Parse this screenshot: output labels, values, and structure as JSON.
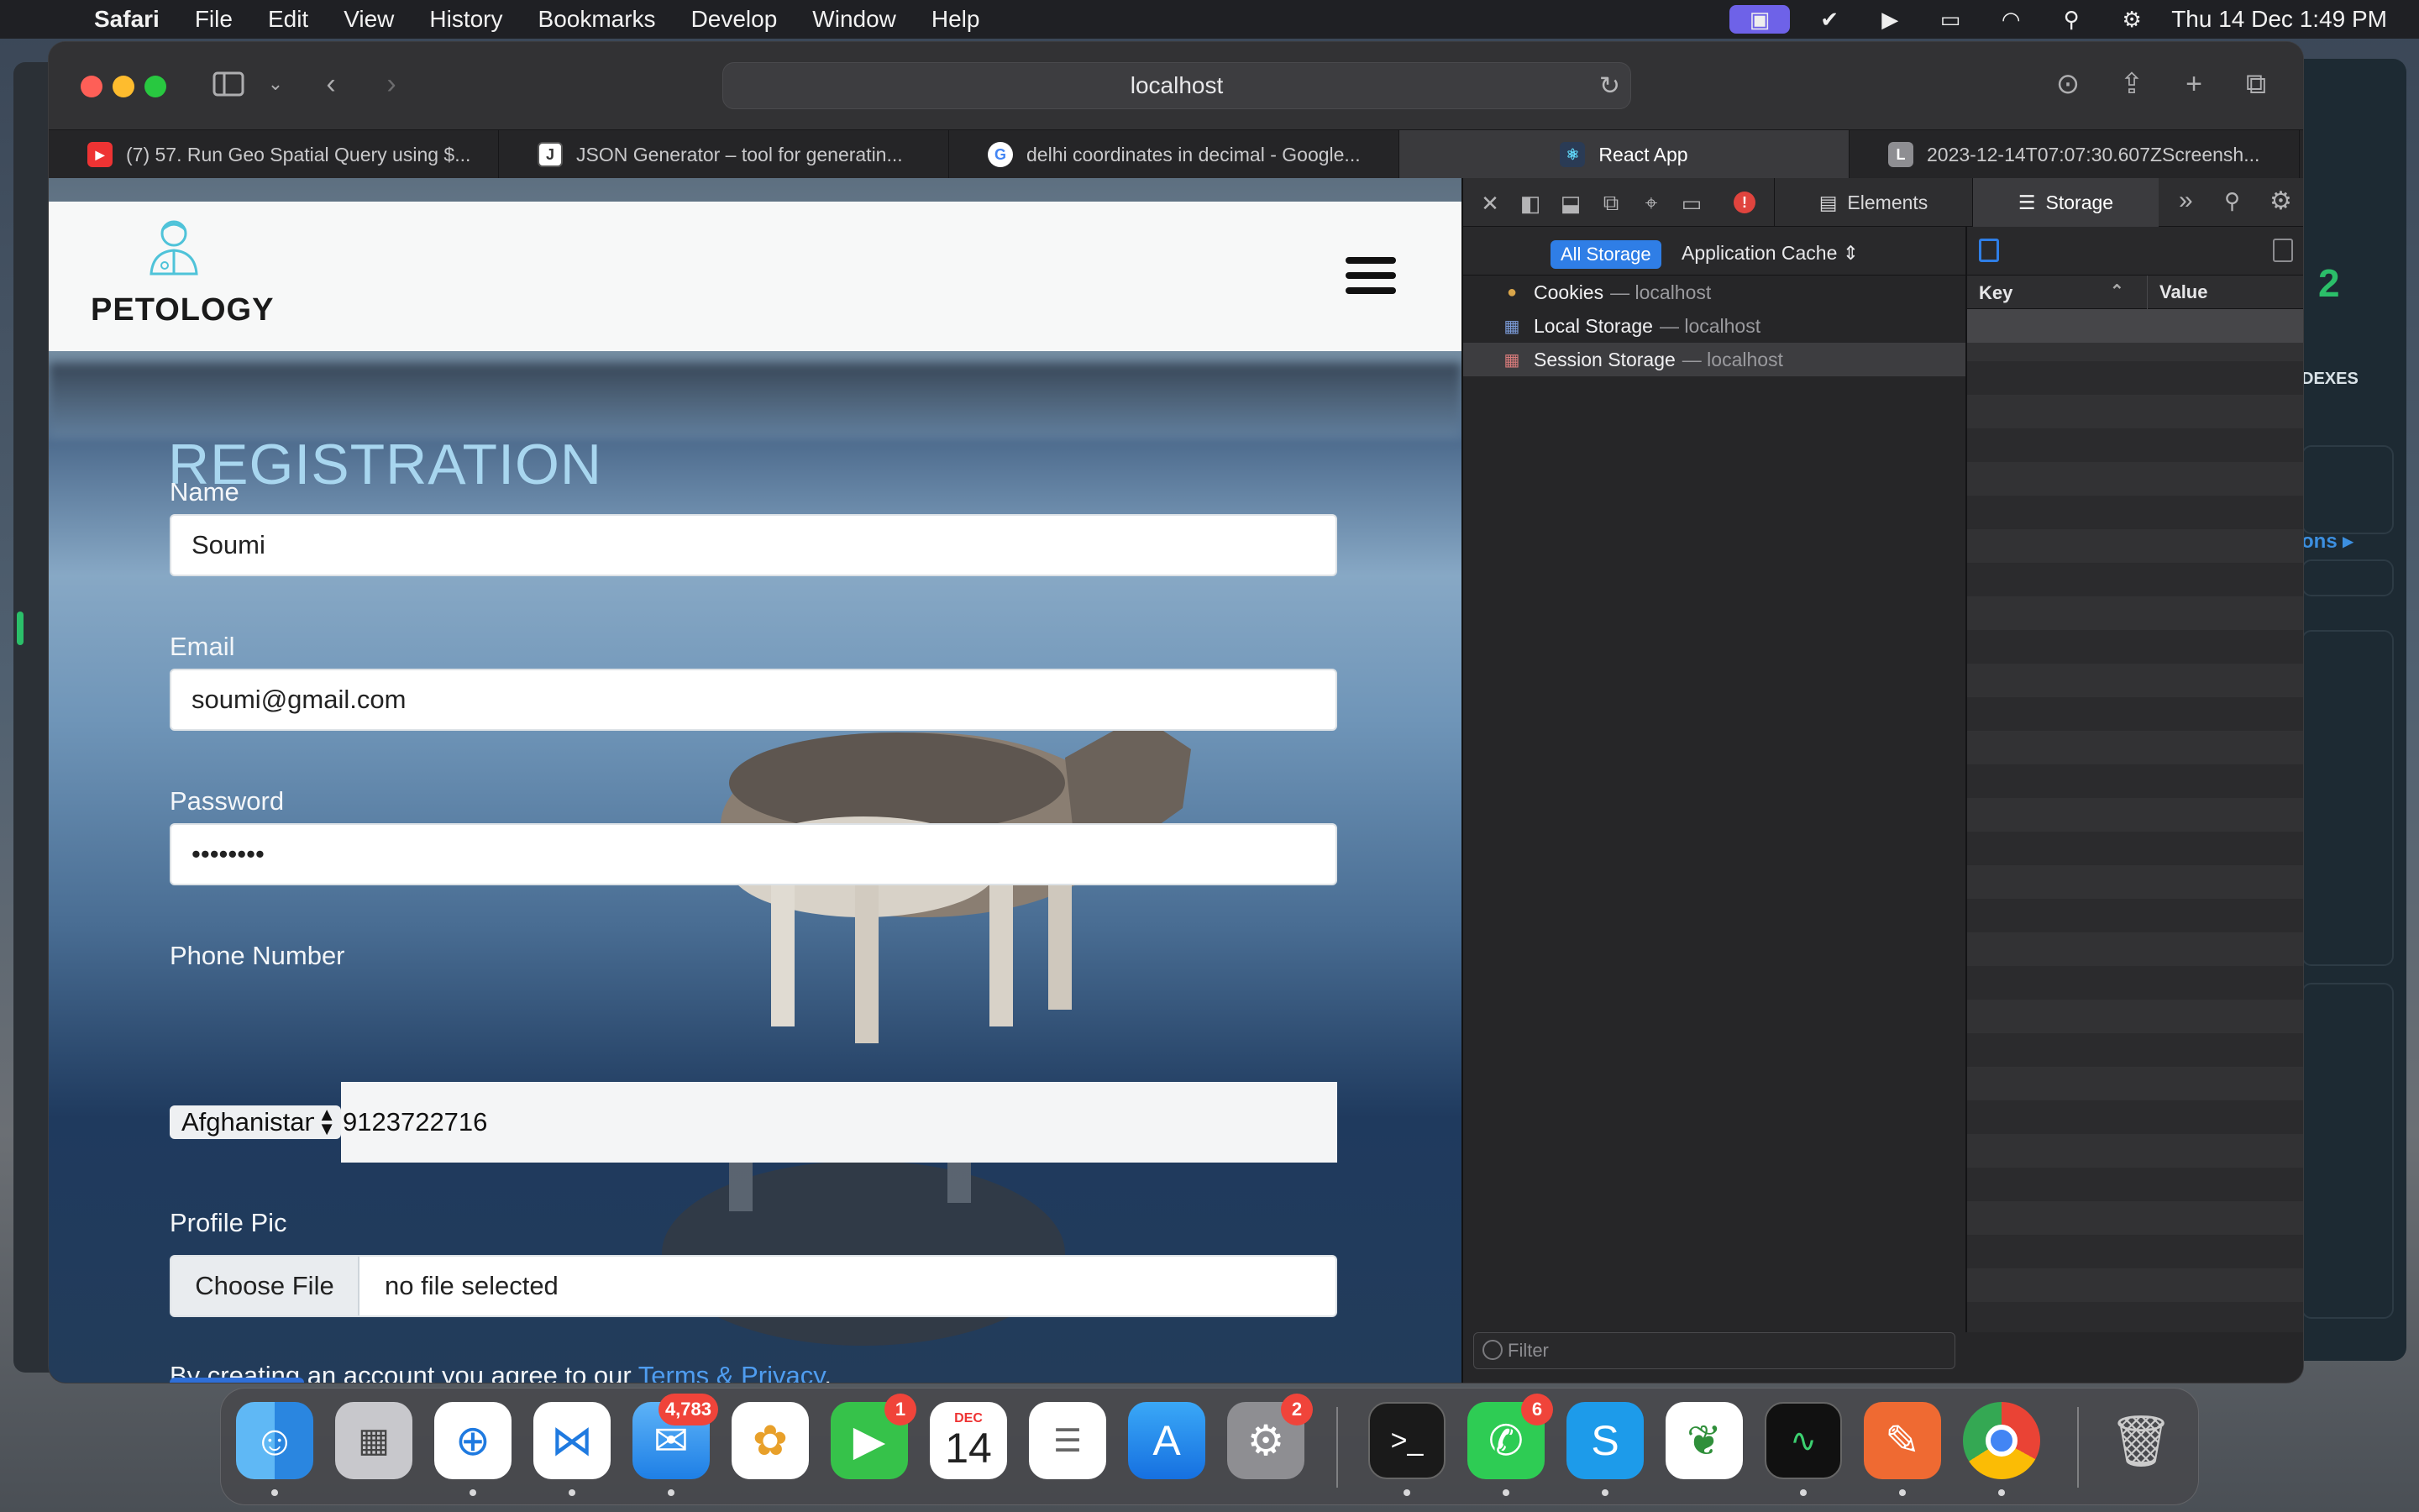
{
  "menubar": {
    "app": "Safari",
    "items": [
      "File",
      "Edit",
      "View",
      "History",
      "Bookmarks",
      "Develop",
      "Window",
      "Help"
    ],
    "clock": "Thu 14 Dec  1:49 PM"
  },
  "browser": {
    "url": "localhost",
    "tabs": [
      {
        "title": "(7) 57. Run Geo Spatial Query using $...",
        "icon": "youtube-icon"
      },
      {
        "title": "JSON Generator – tool for generatin...",
        "icon": "json-generator-icon"
      },
      {
        "title": "delhi coordinates in decimal - Google...",
        "icon": "google-icon"
      },
      {
        "title": "React App",
        "icon": "react-icon"
      },
      {
        "title": "2023-12-14T07:07:30.607ZScreensh...",
        "icon": "letter-l-icon",
        "letter": "L"
      }
    ],
    "active_tab": 3
  },
  "page": {
    "brand": "PETOLOGY",
    "heading": "REGISTRATION",
    "fields": {
      "name_label": "Name",
      "name_value": "Soumi",
      "email_label": "Email",
      "email_value": "soumi@gmail.com",
      "password_label": "Password",
      "password_value": "••••••••",
      "phone_label": "Phone Number",
      "country_value": "Afghanistan",
      "phone_value": "9123722716",
      "pic_label": "Profile Pic",
      "choose_file": "Choose File",
      "no_file": "no file selected"
    },
    "terms_prefix": "By creating an account you agree to our ",
    "terms_link": "Terms & Privacy",
    "terms_suffix": "."
  },
  "devtools": {
    "tabs": {
      "elements": "Elements",
      "storage": "Storage"
    },
    "scope": {
      "all": "All Storage",
      "cache": "Application Cache"
    },
    "storage_items": [
      {
        "name": "Cookies",
        "host": "— localhost",
        "icon": "cookie-icon"
      },
      {
        "name": "Local Storage",
        "host": "— localhost",
        "icon": "table-icon"
      },
      {
        "name": "Session Storage",
        "host": "— localhost",
        "icon": "table-icon"
      }
    ],
    "table": {
      "key_header": "Key",
      "value_header": "Value"
    },
    "filter_placeholder": "Filter"
  },
  "background_window": {
    "count": "2",
    "label": "DEXES",
    "link": "ons ▸"
  },
  "dock": {
    "badges": {
      "mail": "4,783",
      "facetime": "1",
      "settings": "2",
      "whatsapp": "6"
    },
    "calendar_month": "DEC",
    "calendar_day": "14"
  },
  "colors": {
    "accent": "#2f7ee6",
    "heading": "#a8d6ef",
    "link": "#4f9df0",
    "badge": "#f0443a"
  }
}
